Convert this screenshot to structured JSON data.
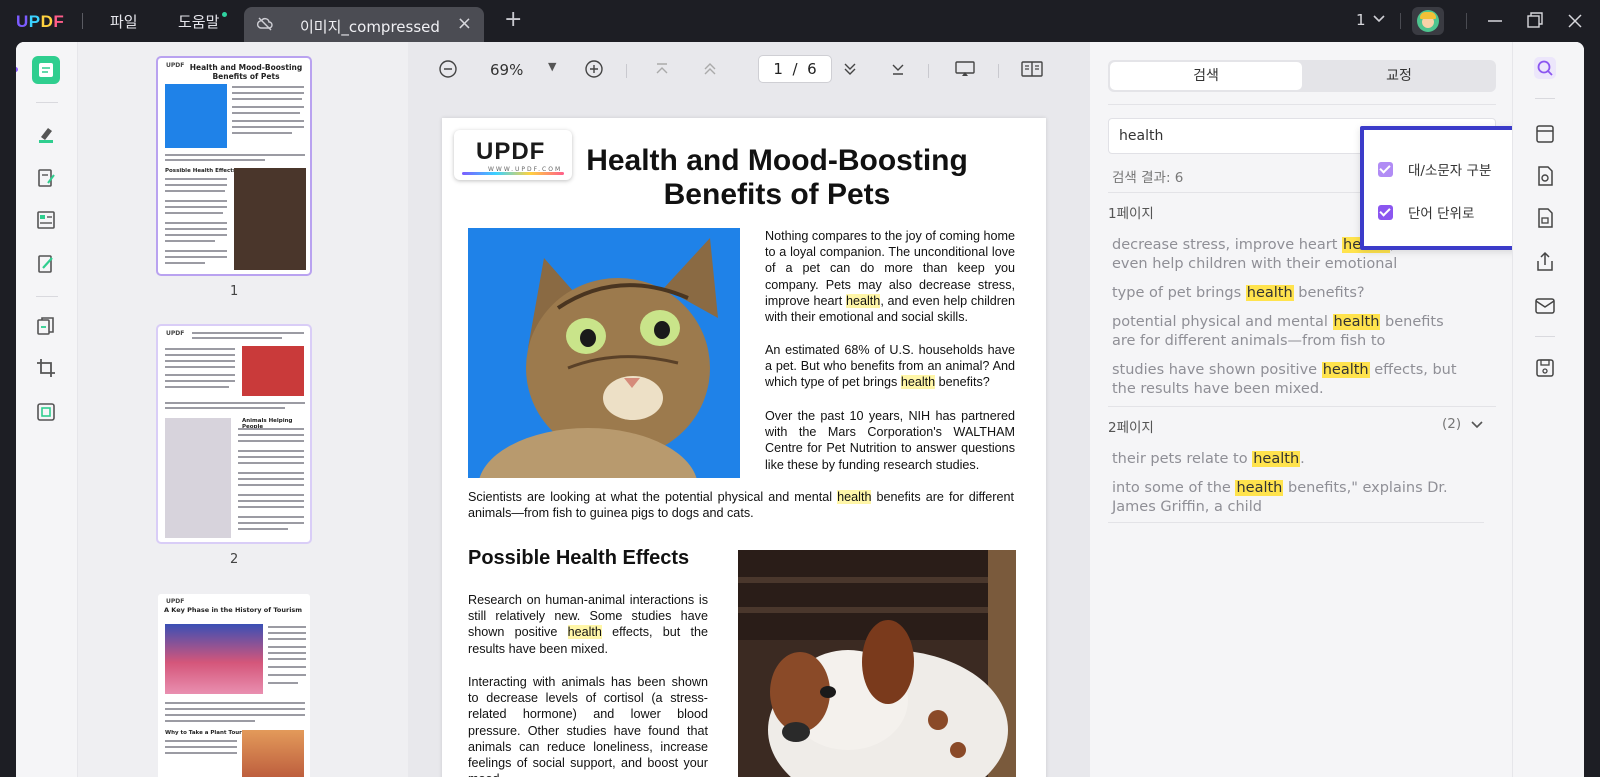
{
  "app": {
    "logo": "UPDF",
    "page_indicator": "1"
  },
  "menu": {
    "file": "파일",
    "help": "도움말"
  },
  "tab": {
    "title": "이미지_compressed"
  },
  "toolbar": {
    "zoom": "69%",
    "page_current": "1",
    "page_total": "6",
    "page_sep": "/"
  },
  "thumbnails": [
    {
      "num": "1",
      "title": "Health and Mood-Boosting Benefits of Pets",
      "section": "Possible Health Effects"
    },
    {
      "num": "2",
      "section": "Animals Helping People"
    },
    {
      "num": "",
      "title": "A Key Phase in the History of Tourism",
      "section": "Why to Take a Plant Tour"
    }
  ],
  "document": {
    "badge": "UPDF",
    "badge_url": "WWW.UPDF.COM",
    "title": "Health and Mood-Boosting Benefits of Pets",
    "p1": {
      "a": "Nothing compares to the joy of coming home to a loyal companion. The unconditional love of a pet can do more than keep you company. Pets may also decrease stress, improve heart ",
      "hl": "health",
      "b": ", and even help children with their emotional and social skills."
    },
    "p2": {
      "a": "An estimated 68% of U.S. households have a pet. But who benefits from an animal? And which type of pet brings ",
      "hl": "health",
      "b": " benefits?"
    },
    "p3": "Over the past 10 years, NIH has partnered with the Mars Corporation's WALTHAM Centre for Pet Nutrition to answer questions like these by funding research studies.",
    "p4": {
      "a": "Scientists are looking at what the potential physical and mental ",
      "hl": "health",
      "b": " benefits are for different animals—from fish to guinea pigs to dogs and cats."
    },
    "h2": "Possible Health Effects",
    "p5": {
      "a": "Research on human-animal interactions is still relatively new. Some studies have shown positive ",
      "hl": "health",
      "b": " effects, but the results have been mixed."
    },
    "p6": "Interacting with animals has been shown to decrease levels of cortisol (a stress-related hormone) and lower blood pressure. Other studies have found that animals can reduce loneliness, increase feelings of social support, and boost your mood."
  },
  "search": {
    "tab_search": "검색",
    "tab_proof": "교정",
    "query": "health",
    "result_count": "검색 결과: 6",
    "filter_options": [
      "대/소문자 구분",
      "단어 단위로"
    ],
    "groups": [
      {
        "label": "1페이지",
        "results": [
          {
            "pre": "decrease stress, improve heart ",
            "hl": "health",
            "post": ", and even help children with their emotional"
          },
          {
            "pre": "type of pet brings ",
            "hl": "health",
            "post": " benefits?"
          },
          {
            "pre": "potential physical and mental ",
            "hl": "health",
            "post": " benefits are for different animals—from fish to"
          },
          {
            "pre": "studies have shown positive ",
            "hl": "health",
            "post": " effects, but the results have been mixed."
          }
        ]
      },
      {
        "label": "2페이지",
        "count": "(2)",
        "results": [
          {
            "pre": "their pets relate to ",
            "hl": "health",
            "post": "."
          },
          {
            "pre": "into some of the ",
            "hl": "health",
            "post": " benefits,\" explains Dr. James Griffin, a child"
          }
        ]
      }
    ]
  },
  "colors": {
    "accent": "#8b56f0",
    "highlight": "#ffe34d",
    "annotation_box": "#3b3bc9",
    "active_tool": "#2fce8f"
  }
}
